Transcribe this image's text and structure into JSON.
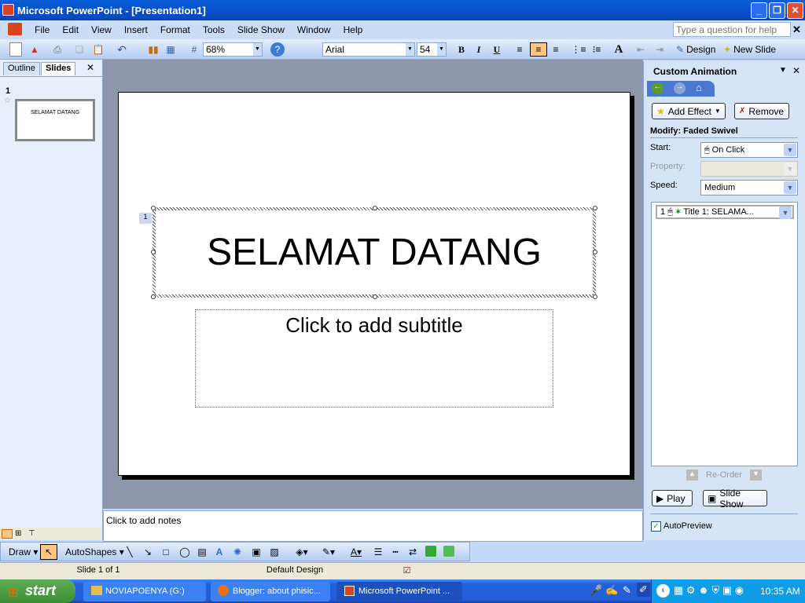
{
  "window": {
    "title": "Microsoft PowerPoint - [Presentation1]",
    "minimize": "_",
    "restore": "❐",
    "close": "✕"
  },
  "menu": [
    "File",
    "Edit",
    "View",
    "Insert",
    "Format",
    "Tools",
    "Slide Show",
    "Window",
    "Help"
  ],
  "help": {
    "placeholder": "Type a question for help",
    "close": "✕"
  },
  "toolbar": {
    "zoom": "68%",
    "font": "Arial",
    "size": "54",
    "bold": "B",
    "italic": "I",
    "underline": "U",
    "design": "Design",
    "new_slide": "New Slide"
  },
  "left_pane": {
    "tabs": [
      "Outline",
      "Slides"
    ],
    "close": "✕",
    "slide_number": "1",
    "thumbnail_text": "SELAMAT DATANG"
  },
  "slide": {
    "title": "SELAMAT DATANG",
    "subtitle": "Click to add subtitle",
    "animation_tag": "1"
  },
  "notes": {
    "placeholder": "Click to add notes"
  },
  "task_pane": {
    "title": "Custom Animation",
    "add_effect": "Add Effect",
    "remove": "Remove",
    "modify": "Modify: Faded Swivel",
    "start_label": "Start:",
    "start_value": "On Click",
    "property_label": "Property:",
    "speed_label": "Speed:",
    "speed_value": "Medium",
    "list": [
      {
        "order": "1",
        "label": "Title 1: SELAMA..."
      }
    ],
    "reorder": "Re-Order",
    "play": "Play",
    "slide_show": "Slide Show",
    "autopreview": "AutoPreview",
    "autopreview_checked": true
  },
  "draw_toolbar": {
    "draw": "Draw",
    "autoshapes": "AutoShapes"
  },
  "status": {
    "slide": "Slide 1 of 1",
    "design": "Default Design"
  },
  "taskbar": {
    "start": "start",
    "tasks": [
      "NOVIAPOENYA (G:)",
      "Blogger: about phisic...",
      "Microsoft PowerPoint ..."
    ],
    "clock": "10:35 AM"
  },
  "colors": {
    "title_bar": "#0653d0",
    "toolbar": "#c9ddf7",
    "slide_area": "#8d96ab",
    "taskbar": "#245edb",
    "start": "#3c8f33",
    "active_align": "#ffc680"
  }
}
